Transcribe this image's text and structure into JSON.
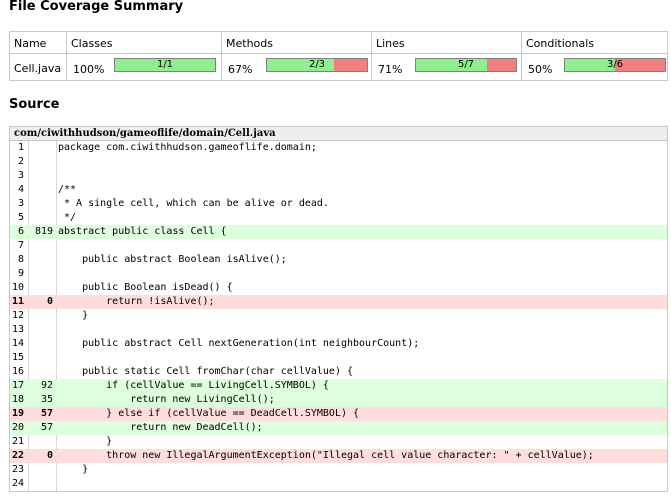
{
  "summary": {
    "title": "File Coverage Summary",
    "headers": {
      "name": "Name",
      "classes": "Classes",
      "methods": "Methods",
      "lines": "Lines",
      "conditionals": "Conditionals"
    },
    "file_name": "Cell.java",
    "classes": {
      "percent": "100%",
      "label": "1/1",
      "fraction": 1.0
    },
    "methods": {
      "percent": "67%",
      "label": "2/3",
      "fraction": 0.67
    },
    "lines": {
      "percent": "71%",
      "label": "5/7",
      "fraction": 0.71
    },
    "conditionals": {
      "percent": "50%",
      "label": "3/6",
      "fraction": 0.5
    }
  },
  "source": {
    "title": "Source",
    "path": "com/ciwithhudson/gameoflife/domain/Cell.java",
    "lines": [
      {
        "n": "1",
        "hits": "",
        "status": "",
        "code": "package com.ciwithhudson.gameoflife.domain;"
      },
      {
        "n": "2",
        "hits": "",
        "status": "",
        "code": ""
      },
      {
        "n": "3",
        "hits": "",
        "status": "",
        "code": ""
      },
      {
        "n": "4",
        "hits": "",
        "status": "",
        "code": "/**"
      },
      {
        "n": "3",
        "hits": "",
        "status": "",
        "code": " * A single cell, which can be alive or dead."
      },
      {
        "n": "5",
        "hits": "",
        "status": "",
        "code": " */"
      },
      {
        "n": "6",
        "hits": "819",
        "status": "hit",
        "code": "abstract public class Cell {"
      },
      {
        "n": "7",
        "hits": "",
        "status": "",
        "code": ""
      },
      {
        "n": "8",
        "hits": "",
        "status": "",
        "code": "    public abstract Boolean isAlive();"
      },
      {
        "n": "9",
        "hits": "",
        "status": "",
        "code": ""
      },
      {
        "n": "10",
        "hits": "",
        "status": "",
        "code": "    public Boolean isDead() {"
      },
      {
        "n": "11",
        "hits": "0",
        "status": "miss",
        "code": "        return !isAlive();"
      },
      {
        "n": "12",
        "hits": "",
        "status": "",
        "code": "    }"
      },
      {
        "n": "13",
        "hits": "",
        "status": "",
        "code": ""
      },
      {
        "n": "14",
        "hits": "",
        "status": "",
        "code": "    public abstract Cell nextGeneration(int neighbourCount);"
      },
      {
        "n": "15",
        "hits": "",
        "status": "",
        "code": ""
      },
      {
        "n": "16",
        "hits": "",
        "status": "",
        "code": "    public static Cell fromChar(char cellValue) {"
      },
      {
        "n": "17",
        "hits": "92",
        "status": "hit",
        "code": "        if (cellValue == LivingCell.SYMBOL) {"
      },
      {
        "n": "18",
        "hits": "35",
        "status": "hit",
        "code": "            return new LivingCell();"
      },
      {
        "n": "19",
        "hits": "57",
        "status": "miss",
        "code": "        } else if (cellValue == DeadCell.SYMBOL) {"
      },
      {
        "n": "20",
        "hits": "57",
        "status": "hit",
        "code": "            return new DeadCell();"
      },
      {
        "n": "21",
        "hits": "",
        "status": "",
        "code": "        }"
      },
      {
        "n": "22",
        "hits": "0",
        "status": "miss",
        "code": "        throw new IllegalArgumentException(\"Illegal cell value character: \" + cellValue);"
      },
      {
        "n": "23",
        "hits": "",
        "status": "",
        "code": "    }"
      },
      {
        "n": "24",
        "hits": "",
        "status": "",
        "code": ""
      },
      {
        "n": "25",
        "hits": "",
        "status": "",
        "code": "}"
      }
    ]
  },
  "colors": {
    "covered_bar": "#90ee90",
    "uncovered_bar": "#f08080",
    "covered_line": "#ddffdd",
    "uncovered_line": "#ffdddd"
  }
}
